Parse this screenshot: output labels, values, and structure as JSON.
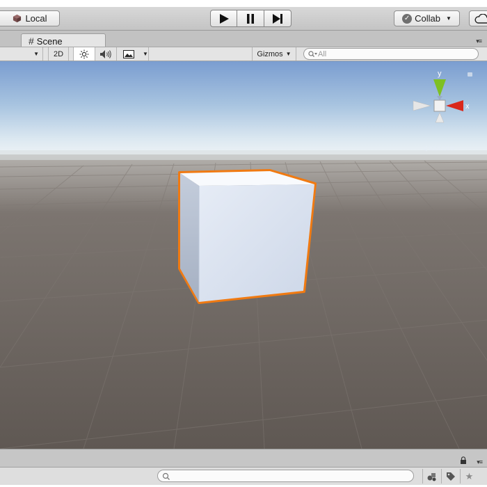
{
  "toolbar": {
    "local_label": "Local",
    "collab_label": "Collab",
    "play_icons": [
      "play-icon",
      "pause-icon",
      "step-icon"
    ]
  },
  "tab": {
    "label": "Scene"
  },
  "scene_toolbar": {
    "mode_2d": "2D",
    "gizmos_label": "Gizmos",
    "search_placeholder": "All",
    "lighting_active": true
  },
  "viewport": {
    "orientation_gizmo": {
      "y_label": "y",
      "x_label": "x"
    },
    "selected_object": "cube",
    "colors": {
      "sky_top": "#7b9ed1",
      "sky_horizon": "#eef3f6",
      "ground": "#665f5a",
      "cube_front": "#d9e2f1",
      "cube_top": "#f7f9fc",
      "cube_side": "#aeb9cc",
      "selection_outline": "#f07a12",
      "axis_x": "#d9281b",
      "axis_y": "#7ec022"
    }
  },
  "bottom": {
    "search_value": ""
  }
}
